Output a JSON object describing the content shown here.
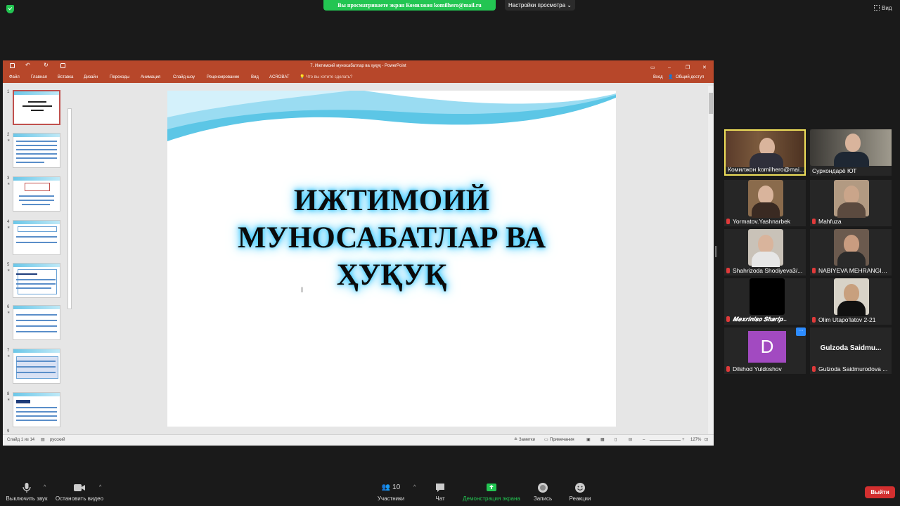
{
  "zoom": {
    "share_banner": "Вы просматриваете экран Комилжон komilhero@mail.ru",
    "view_settings": "Настройки просмотра",
    "view_button": "Вид"
  },
  "powerpoint": {
    "title": "7. Ижтимоий муносабатлар ва ҳуқуқ  -  PowerPoint",
    "ribbon_tabs": [
      "Файл",
      "Главная",
      "Вставка",
      "Дизайн",
      "Переходы",
      "Анимация",
      "Слайд-шоу",
      "Рецензирование",
      "Вид",
      "ACROBAT"
    ],
    "tell_me": "Что вы хотите сделать?",
    "sign_in": "Вход",
    "share": "Общий доступ",
    "slide_numbers": [
      "1",
      "2",
      "3",
      "4",
      "5",
      "6",
      "7",
      "8",
      "9"
    ],
    "slide_title": [
      "ИЖТИМОИЙ",
      "МУНОСАБАТЛАР ВА",
      "ҲУҚУҚ"
    ],
    "status": {
      "slide": "Слайд 1 из 14",
      "lang": "русский",
      "notes": "Заметки",
      "comments": "Примечания",
      "zoom": "127%"
    }
  },
  "participants": [
    {
      "name": "Комилжон komilhero@mai...",
      "muted": false,
      "speaking": true
    },
    {
      "name": "Сурхондарё ЮТ",
      "muted": false,
      "speaking": false
    },
    {
      "name": "Yormatov.Yashnarbek",
      "muted": true,
      "speaking": false
    },
    {
      "name": "Mahfuza",
      "muted": true,
      "speaking": false
    },
    {
      "name": "Shahrizoda Shodiyeva3/...",
      "muted": true,
      "speaking": false
    },
    {
      "name": "NABIYEVA MEHRANGIZ3...",
      "muted": true,
      "speaking": false
    },
    {
      "name": "𝑴𝒆𝒙𝒓𝒊𝒏𝒊𝒔𝒐 𝑺𝒉𝒂𝒓𝒊𝒑...",
      "muted": true,
      "speaking": false
    },
    {
      "name": "Olim Utapo'latov 2-21",
      "muted": true,
      "speaking": false
    },
    {
      "name": "Dilshod Yuldoshov",
      "muted": true,
      "speaking": false,
      "avatar_letter": "D"
    },
    {
      "name": "Gulzoda Saidmurodova ...",
      "muted": true,
      "speaking": false,
      "display_name": "Gulzoda  Saidmu..."
    }
  ],
  "toolbar": {
    "mute": "Выключить звук",
    "video": "Остановить видео",
    "participants": "Участники",
    "participants_count": "10",
    "chat": "Чат",
    "share": "Демонстрация экрана",
    "record": "Запись",
    "reactions": "Реакции",
    "leave": "Выйти"
  },
  "colors": {
    "zoom_green": "#23c552",
    "ppt_accent": "#b7472a",
    "leave_red": "#d32f2f",
    "glow": "#38c8ff"
  }
}
